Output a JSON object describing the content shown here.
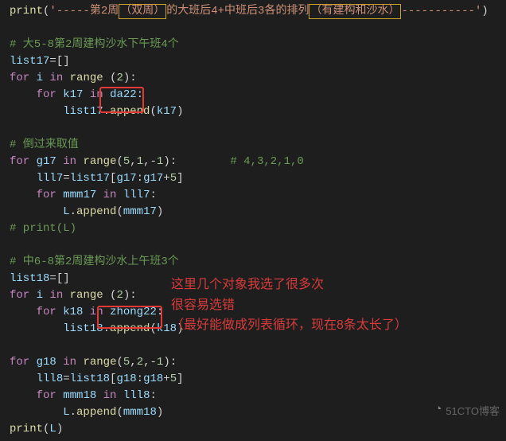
{
  "print_line": {
    "prefix": "'-----第2周",
    "yb1": "（双周）",
    "mid1": "的大班后4+中班后3各的排列",
    "yb2": "（有建构和沙水）",
    "suffix": "-----------'"
  },
  "comment_a": "# 大5-8第2周建构沙水下午班4个",
  "l1": "list17=[]",
  "l2a": "for i in range (",
  "l2n": "2",
  "l2b": "):",
  "l3a": "    for k17 in ",
  "l3_hi": "da22:",
  "l4": "        list17.append(k17)",
  "comment_b": "# 倒过来取值",
  "l5": "for g17 in range(5,1,-1):        ",
  "l5c": "# 4,3,2,1,0",
  "l6": "    lll7=list17[g17:g17+5]",
  "l7": "    for mmm17 in lll7:",
  "l8": "        L.append(mmm17)",
  "l9c": "# print(L)",
  "comment_c": "# 中6-8第2周建构沙水上午班3个",
  "l10": "list18=[]",
  "l11": "for i in range (2):",
  "l12a": "    for k18 in ",
  "l12_hi": "zhong22:",
  "l13": "        list18.append(k18)",
  "l14": "for g18 in range(5,2,-1):",
  "l15": "    lll8=list18[g18:g18+5]",
  "l16": "    for mmm18 in lll8:",
  "l17": "        L.append(mmm18)",
  "l18": "print(L)",
  "annot1": "这里几个对象我选了很多次",
  "annot2": "很容易选错",
  "annot3": "（最好能做成列表循环，现在8条太长了）",
  "watermark": "51CTO博客"
}
